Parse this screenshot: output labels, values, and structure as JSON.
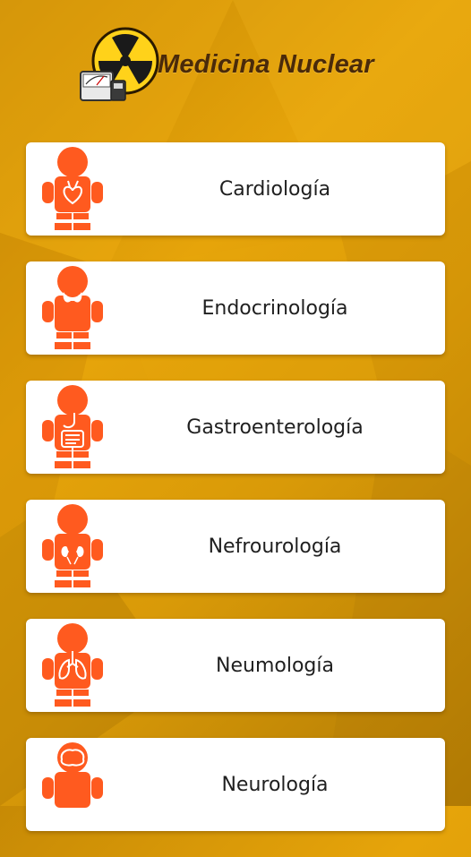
{
  "app": {
    "title": "Medicina Nuclear",
    "logo_icon": "radiation-symbol-with-gamma-counter-icon"
  },
  "colors": {
    "background": "#e0a008",
    "figure": "#ff5a1f",
    "card": "#ffffff",
    "title_text": "#4a2a0a"
  },
  "specialties": [
    {
      "label": "Cardiología",
      "icon": "body-heart-icon"
    },
    {
      "label": "Endocrinología",
      "icon": "body-thyroid-icon"
    },
    {
      "label": "Gastroenterología",
      "icon": "body-digestive-icon"
    },
    {
      "label": "Nefrourología",
      "icon": "body-kidneys-icon"
    },
    {
      "label": "Neumología",
      "icon": "body-lungs-icon"
    },
    {
      "label": "Neurología",
      "icon": "body-brain-icon"
    }
  ]
}
